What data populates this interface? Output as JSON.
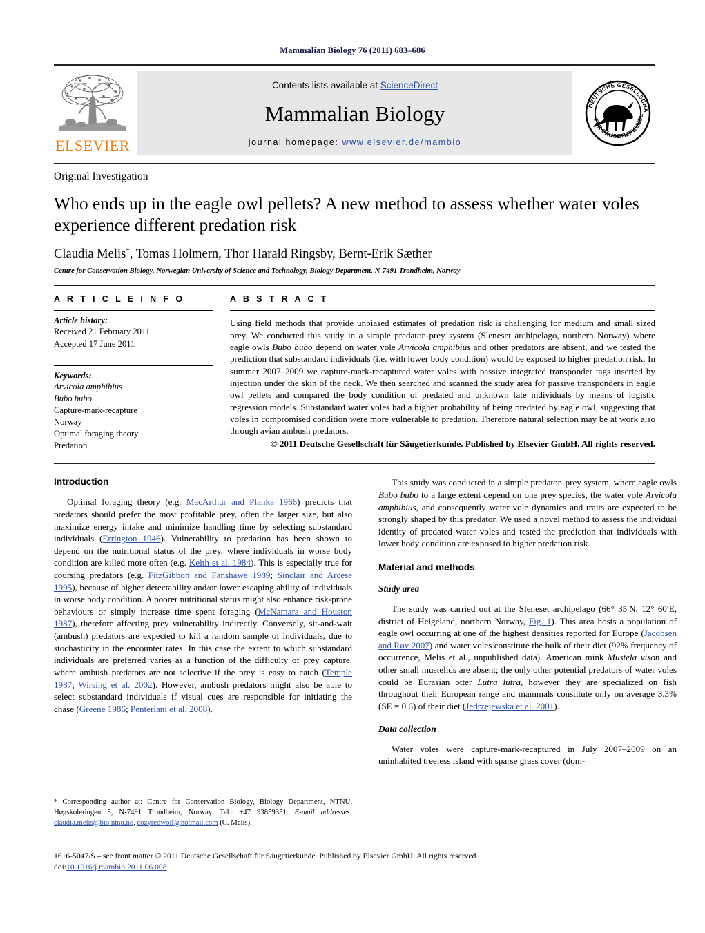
{
  "running_head": "Mammalian Biology 76 (2011) 683–686",
  "banner": {
    "contents_prefix": "Contents lists available at ",
    "sciencedirect": "ScienceDirect",
    "journal_title": "Mammalian Biology",
    "homepage_prefix": "journal homepage: ",
    "homepage_url": "www.elsevier.de/mambio",
    "elsevier_wordmark": "ELSEVIER",
    "society_seal_text": "DEUTSCHE GESELLSCHAFT FÜR SÄUGETIERKUNDE",
    "link_color": "#2b50a8",
    "elsevier_orange": "#f07f13",
    "banner_bg": "#e7e7e7"
  },
  "title_block": {
    "article_kind": "Original Investigation",
    "title": "Who ends up in the eagle owl pellets? A new method to assess whether water voles experience different predation risk",
    "authors": "Claudia Melis",
    "authors_rest": ", Tomas Holmern, Thor Harald Ringsby, Bernt-Erik Sæther",
    "corresponding_marker": "*",
    "affiliation": "Centre for Conservation Biology, Norwegian University of Science and Technology, Biology Department, N-7491 Trondheim, Norway"
  },
  "article_info": {
    "heading": "A R T I C L E    I N F O",
    "history_label": "Article history:",
    "history": [
      "Received 21 February 2011",
      "Accepted 17 June 2011"
    ],
    "keywords_label": "Keywords:",
    "keywords": [
      "Arvicola amphibius",
      "Bubo bubo",
      "Capture-mark-recapture",
      "Norway",
      "Optimal foraging theory",
      "Predation"
    ],
    "keywords_italic": [
      true,
      true,
      false,
      false,
      false,
      false
    ]
  },
  "abstract": {
    "heading": "A B S T R A C T",
    "text_1": "Using field methods that provide unbiased estimates of predation risk is challenging for medium and small sized prey. We conducted this study in a simple predator–prey system (Sleneset archipelago, northern Norway) where eagle owls ",
    "sp_1": "Bubo bubo",
    "text_2": " depend on water vole ",
    "sp_2": "Arvicola amphibius",
    "text_3": " and other predators are absent, and we tested the prediction that substandard individuals (i.e. with lower body condition) would be exposed to higher predation risk. In summer 2007–2009 we capture-mark-recaptured water voles with passive integrated transponder tags inserted by injection under the skin of the neck. We then searched and scanned the study area for passive transponders in eagle owl pellets and compared the body condition of predated and unknown fate individuals by means of logistic regression models. Substandard water voles had a higher probability of being predated by eagle owl, suggesting that voles in compromised condition were more vulnerable to predation. Therefore natural selection may be at work also through avian ambush predators.",
    "copyright": "© 2011 Deutsche Gesellschaft für Säugetierkunde. Published by Elsevier GmbH. All rights reserved."
  },
  "body": {
    "intro_heading": "Introduction",
    "intro_p1_a": "Optimal foraging theory (e.g. ",
    "intro_p1_c1": "MacArthur and Planka 1966",
    "intro_p1_b": ") predicts that predators should prefer the most profitable prey, often the larger size, but also maximize energy intake and minimize handling time by selecting substandard individuals (",
    "intro_p1_c2": "Errington 1946",
    "intro_p1_c": "). Vulnerability to predation has been shown to depend on the nutritional status of the prey, where individuals in worse body condition are killed more often (e.g. ",
    "intro_p1_c3": "Keith et al. 1984",
    "intro_p1_d": "). This is especially true for coursing predators (e.g. ",
    "intro_p1_c4": "FitzGibbon and Fanshawe 1989",
    "intro_p1_e": "; ",
    "intro_p1_c5": "Sinclair and Arcese 1995",
    "intro_p1_f": "), because of higher detectability and/or lower escaping ability of individuals in worse body condition. A poorer nutritional status might also enhance risk-prone behaviours or simply increase time spent foraging (",
    "intro_p1_c6": "McNamara and Houston 1987",
    "intro_p1_g": "), therefore affecting prey vulnerability indirectly. Conversely, sit-and-wait (ambush) predators are expected to kill a random sample of individuals, due to stochasticity in the encounter rates. In this case the extent to which substandard individuals are preferred varies as a function of the difficulty of prey capture, where ambush predators are not selective if the prey is easy to catch (",
    "intro_p1_c7": "Temple 1987",
    "intro_p1_h": "; ",
    "intro_p1_c8": "Wirsing et al. 2002",
    "intro_p1_i": "). However, ambush predators might also be able to select substandard individuals if visual cues are responsible for initiating the chase (",
    "intro_p1_c9": "Greene 1986",
    "intro_p1_j": "; ",
    "intro_p1_c10": "Penteriani et al. 2008",
    "intro_p1_k": ").",
    "right_p1_a": "This study was conducted in a simple predator–prey system, where eagle owls ",
    "right_p1_sp1": "Bubo bubo",
    "right_p1_b": " to a large extent depend on one prey species, the water vole ",
    "right_p1_sp2": "Arvicola amphibius",
    "right_p1_c": ", and consequently water vole dynamics and traits are expected to be strongly shaped by this predator. We used a novel method to assess the individual identity of predated water voles and tested the prediction that individuals with lower body condition are exposed to higher predation risk.",
    "methods_heading": "Material and methods",
    "study_area_heading": "Study area",
    "study_p1_a": "The study was carried out at the Sleneset archipelago (66° 35′N, 12° 60′E, district of Helgeland, northern Norway, ",
    "study_p1_fig": "Fig. 1",
    "study_p1_b": "). This area hosts a population of eagle owl occurring at one of the highest densities reported for Europe (",
    "study_p1_c1": "Jacobsen and Røv 2007",
    "study_p1_c": ") and water voles constitute the bulk of their diet (92% frequency of occurrence, Melis et al., unpublished data). American mink ",
    "study_p1_sp1": "Mustela vison",
    "study_p1_d": " and other small mustelids are absent; the only other potential predators of water voles could be Eurasian otter ",
    "study_p1_sp2": "Lutra lutra",
    "study_p1_e": ", however they are specialized on fish throughout their European range and mammals constitute only on average 3.3% (SE = 0.6) of their diet (",
    "study_p1_c2": "Jedrzejewska et al. 2001",
    "study_p1_f": ").",
    "data_heading": "Data collection",
    "data_p1": "Water voles were capture-mark-recaptured in July 2007–2009 on an uninhabited treeless island with sparse grass cover (dom-"
  },
  "footnote": {
    "star": "*",
    "line1": " Corresponding author at: Centre for Conservation Biology, Biology Department, NTNU, Høgskoleringen 5, N-7491 Trondheim, Norway. Tel.: +47 93859351.",
    "email_label": "E-mail addresses:",
    "email1": "claudia.melis@bio.ntnu.no",
    "email_sep": ", ",
    "email2": "cozyredwolf@hotmail.com",
    "email_tail": "(C. Melis)."
  },
  "footer": {
    "line1": "1616-5047/$ – see front matter © 2011 Deutsche Gesellschaft für Säugetierkunde. Published by Elsevier GmbH. All rights reserved.",
    "doi_label": "doi:",
    "doi": "10.1016/j.mambio.2011.06.008"
  }
}
